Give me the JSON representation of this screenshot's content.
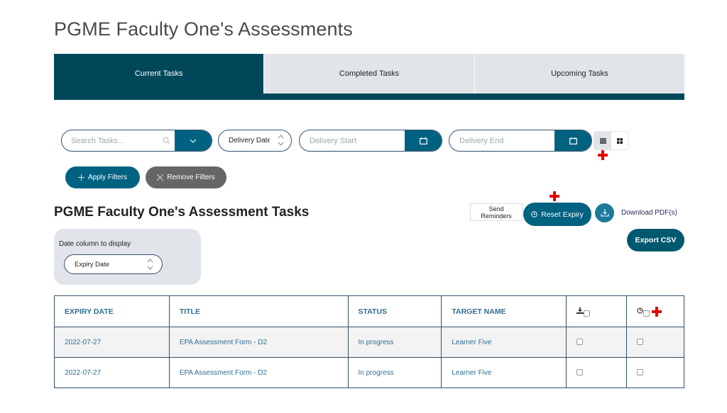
{
  "page": {
    "title": "PGME Faculty One's Assessments"
  },
  "tabs": [
    {
      "label": "Current Tasks",
      "active": true
    },
    {
      "label": "Completed Tasks",
      "active": false
    },
    {
      "label": "Upcoming Tasks",
      "active": false
    }
  ],
  "filters": {
    "search_placeholder": "Search Tasks...",
    "date_type_selected": "Delivery Date",
    "delivery_start_placeholder": "Delivery Start",
    "delivery_end_placeholder": "Delivery End",
    "apply_label": "Apply Filters",
    "remove_label": "Remove Filters",
    "view_mode": "list"
  },
  "section": {
    "title": "PGME Faculty One's Assessment Tasks",
    "date_column_label": "Date column to display",
    "date_column_selected": "Expiry Date"
  },
  "actions": {
    "send_reminders": "Send Reminders",
    "reset_expiry": "Reset Expiry",
    "download_pdfs": "Download PDF(s)",
    "export_csv": "Export CSV"
  },
  "table": {
    "columns": [
      "EXPIRY DATE",
      "TITLE",
      "STATUS",
      "TARGET NAME"
    ],
    "rows": [
      {
        "expiry_date": "2022-07-27",
        "title": "EPA Assessment Form - D2",
        "status": "In progress",
        "target_name": "Learner Five",
        "download_checked": false,
        "reset_checked": false
      },
      {
        "expiry_date": "2022-07-27",
        "title": "EPA Assessment Form - D2",
        "status": "In progress",
        "target_name": "Learner Five",
        "download_checked": false,
        "reset_checked": false
      }
    ]
  },
  "colors": {
    "primary": "#00475a",
    "button": "#006281",
    "tab_inactive": "#e1e5ea",
    "link_text": "#2e6f93",
    "marker_red": "#e60000"
  }
}
